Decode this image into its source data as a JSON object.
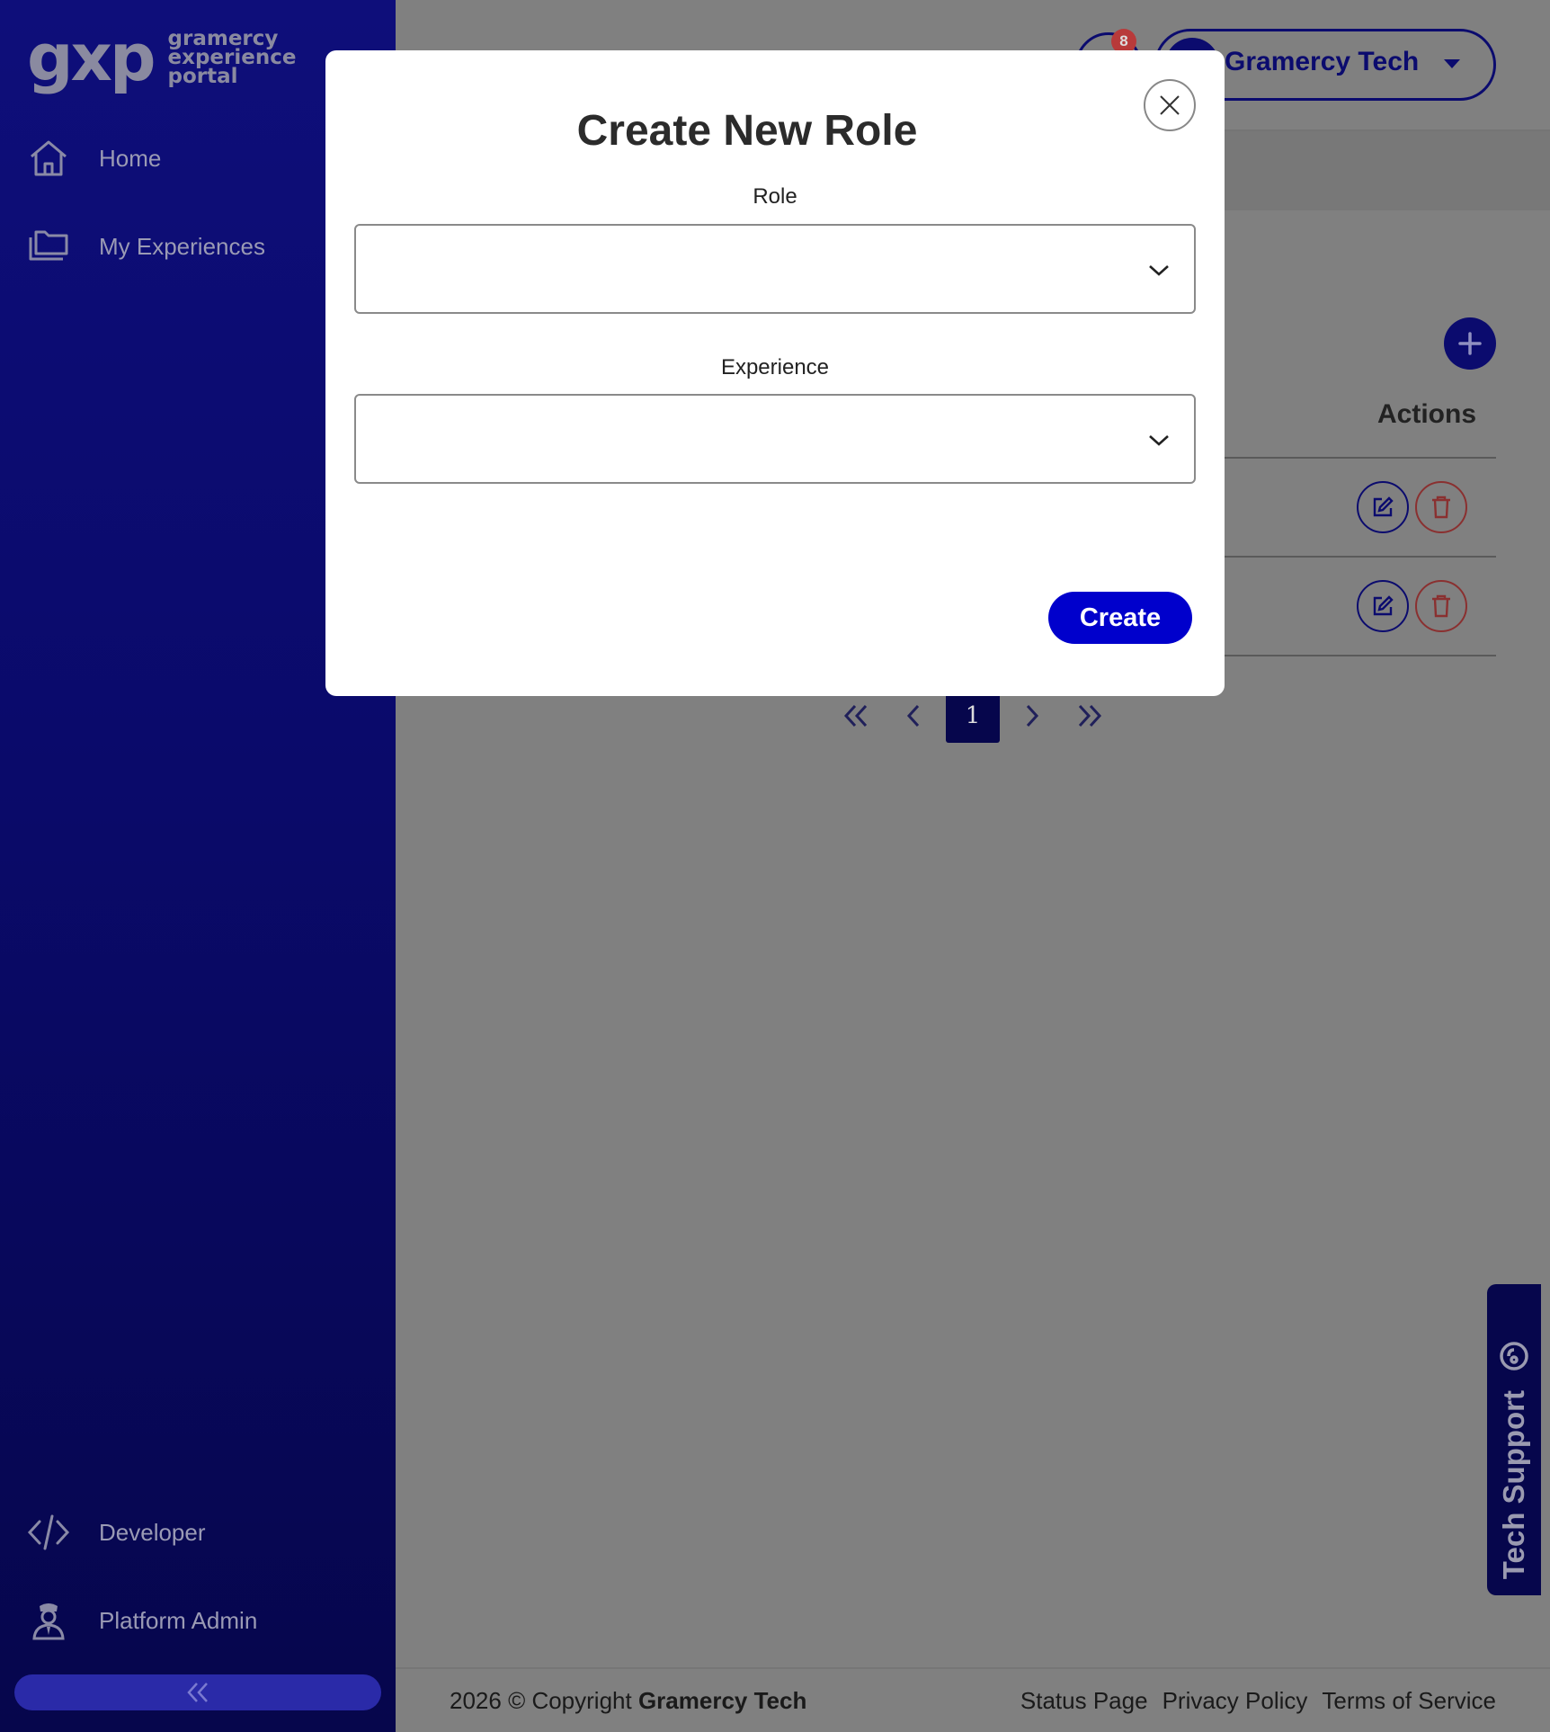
{
  "brand": {
    "logo_mark": "gxp",
    "logo_words": [
      "gramercy",
      "experience",
      "portal"
    ]
  },
  "sidebar": {
    "items": [
      {
        "label": "Home",
        "icon": "home-icon"
      },
      {
        "label": "My Experiences",
        "icon": "folders-icon"
      }
    ],
    "bottom_items": [
      {
        "label": "Developer",
        "icon": "code-icon"
      },
      {
        "label": "Platform Admin",
        "icon": "admin-user-icon"
      }
    ],
    "collapse_icon": "double-chevron-left-icon"
  },
  "header": {
    "notification_count": "8",
    "profile_name": "Gramercy Tech"
  },
  "table": {
    "actions_header": "Actions",
    "row_count": 2
  },
  "pagination": {
    "current_page": "1"
  },
  "modal": {
    "title": "Create New Role",
    "role_label": "Role",
    "role_value": "",
    "experience_label": "Experience",
    "experience_value": "",
    "create_label": "Create"
  },
  "footer": {
    "copyright_prefix": "2026 © Copyright",
    "copyright_owner": "Gramercy Tech",
    "links": [
      "Status Page",
      "Privacy Policy",
      "Terms of Service"
    ]
  },
  "tech_support": {
    "label": "Tech Support"
  },
  "colors": {
    "sidebar": "#0e0e7a",
    "primary": "#0000cc",
    "overlay": "#808080"
  }
}
